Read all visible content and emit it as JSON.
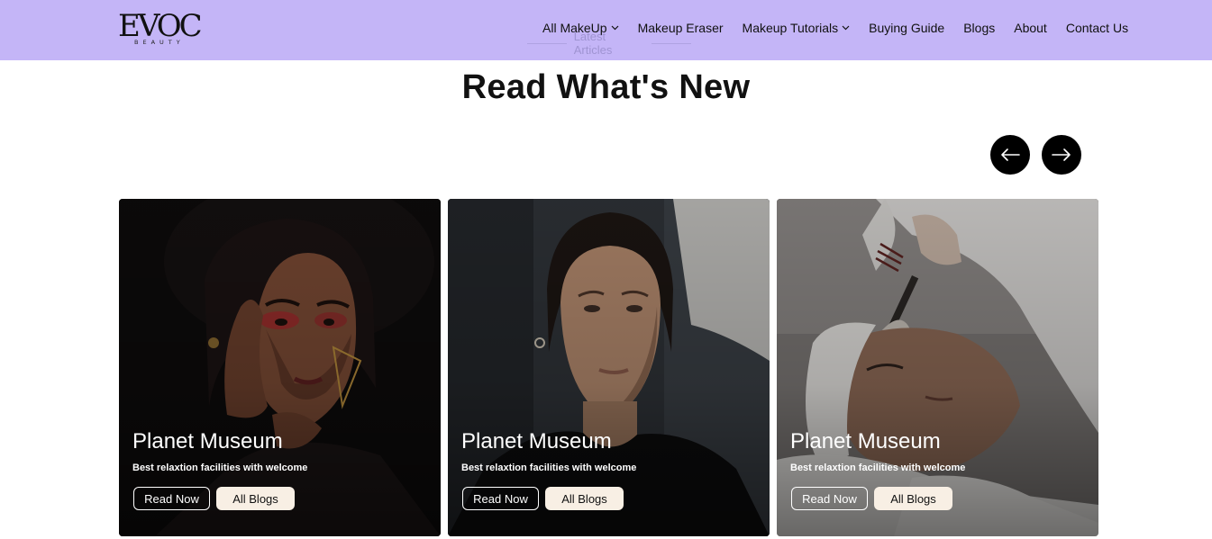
{
  "brand": {
    "logo_main": "EVOC",
    "logo_sub": "BEAUTY"
  },
  "nav": {
    "items": [
      {
        "label": "All MakeUp",
        "has_dropdown": true
      },
      {
        "label": "Makeup Eraser",
        "has_dropdown": false
      },
      {
        "label": "Makeup Tutorials",
        "has_dropdown": true
      },
      {
        "label": "Buying Guide",
        "has_dropdown": false
      },
      {
        "label": "Blogs",
        "has_dropdown": false
      },
      {
        "label": "About",
        "has_dropdown": false
      },
      {
        "label": "Contact Us",
        "has_dropdown": false
      }
    ]
  },
  "section": {
    "eyebrow": "Latest Articles",
    "title": "Read What's New"
  },
  "carousel": {
    "prev_icon": "arrow-left-icon",
    "next_icon": "arrow-right-icon"
  },
  "cards": [
    {
      "title": "Planet Museum",
      "description": "Best relaxtion facilities with welcome",
      "read_label": "Read Now",
      "all_label": "All Blogs"
    },
    {
      "title": "Planet Museum",
      "description": "Best relaxtion facilities with welcome",
      "read_label": "Read Now",
      "all_label": "All Blogs"
    },
    {
      "title": "Planet Museum",
      "description": "Best relaxtion facilities with welcome",
      "read_label": "Read Now",
      "all_label": "All Blogs"
    }
  ],
  "colors": {
    "navbar_bg": "#c4b5f7",
    "button_dark": "#000000",
    "all_blogs_bg": "#f8efe4"
  }
}
